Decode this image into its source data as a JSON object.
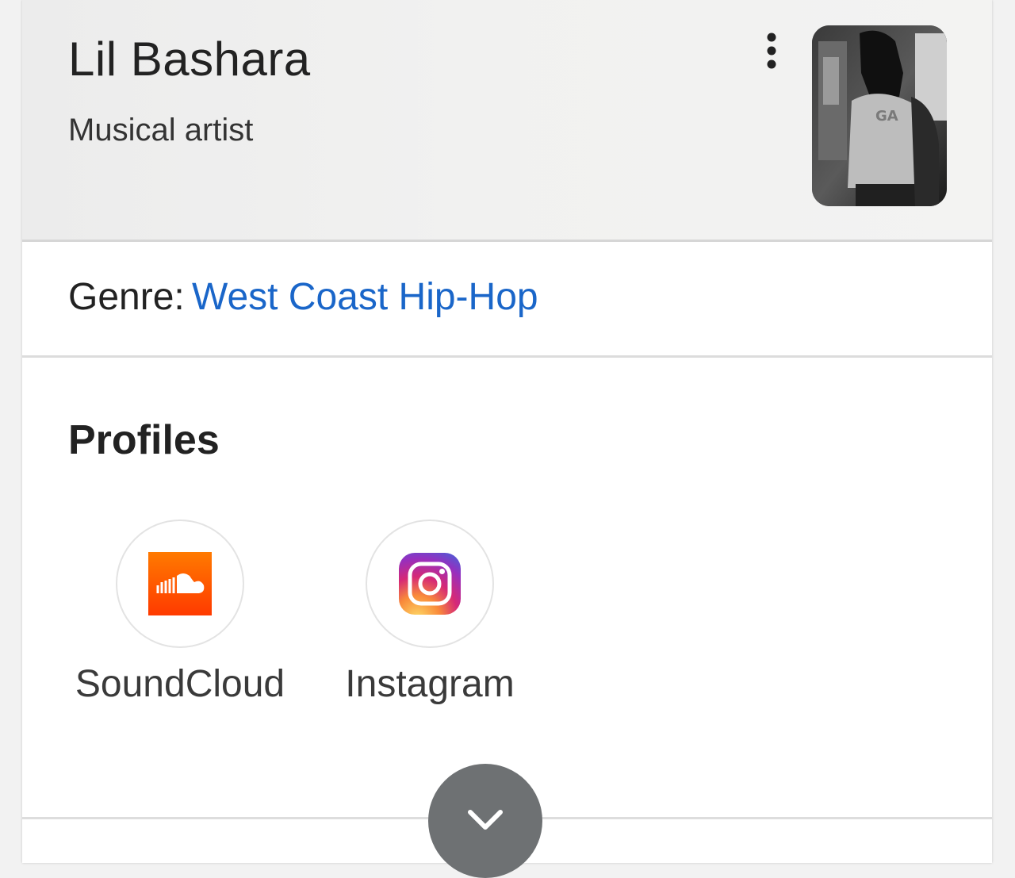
{
  "header": {
    "title": "Lil Bashara",
    "subtitle": "Musical artist",
    "menu_icon": "more-vert-icon",
    "photo_alt": "artist-photo"
  },
  "genre": {
    "label": "Genre: ",
    "value": "West Coast Hip-Hop",
    "link_color": "#1a66c9"
  },
  "profiles": {
    "title": "Profiles",
    "items": [
      {
        "label": "SoundCloud",
        "icon": "soundcloud-icon",
        "color": "#ff5500"
      },
      {
        "label": "Instagram",
        "icon": "instagram-icon",
        "color": "#c13584"
      }
    ]
  },
  "expand_button": {
    "icon": "chevron-down-icon"
  }
}
